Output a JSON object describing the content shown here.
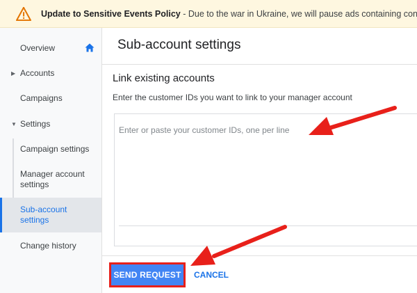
{
  "banner": {
    "title": "Update to Sensitive Events Policy",
    "message": " - Due to the war in Ukraine, we will pause ads containing content that",
    "icon": "warning-icon",
    "icon_color": "#e37400",
    "background": "#fef7e0"
  },
  "sidebar": {
    "overview": "Overview",
    "accounts": "Accounts",
    "campaigns": "Campaigns",
    "settings": "Settings",
    "campaign_settings": "Campaign settings",
    "manager_account_settings_1": "Manager account",
    "manager_account_settings_2": "settings",
    "sub_account_settings_1": "Sub-account",
    "sub_account_settings_2": "settings",
    "change_history": "Change history",
    "active_color": "#1a73e8"
  },
  "main": {
    "title": "Sub-account settings",
    "section_title": "Link existing accounts",
    "section_desc": "Enter the customer IDs you want to link to your manager account",
    "ids_placeholder": "Enter or paste your customer IDs, one per line",
    "ids_value": ""
  },
  "actions": {
    "send": "SEND REQUEST",
    "cancel": "CANCEL",
    "primary_color": "#4285f4",
    "highlight_color": "#e8201a"
  }
}
